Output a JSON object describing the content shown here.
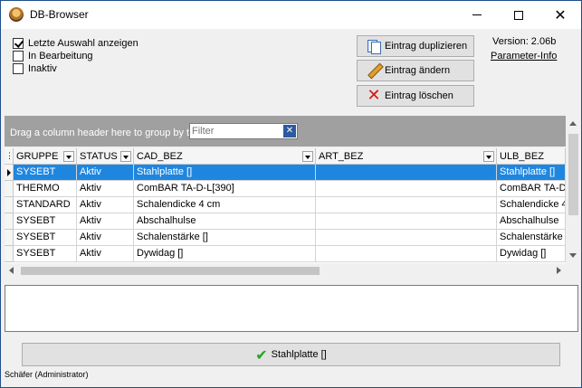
{
  "window": {
    "title": "DB-Browser"
  },
  "options": [
    {
      "label": "Letzte Auswahl anzeigen",
      "checked": true
    },
    {
      "label": "In Bearbeitung",
      "checked": false
    },
    {
      "label": "Inaktiv",
      "checked": false
    }
  ],
  "actions": {
    "duplicate": "Eintrag duplizieren",
    "edit": "Eintrag ändern",
    "delete": "Eintrag löschen"
  },
  "info": {
    "version": "Version: 2.06b",
    "param_link": "Parameter-Info"
  },
  "grid": {
    "group_hint": "Drag a column header here to group by t",
    "filter_placeholder": "Filter",
    "columns": [
      "GRUPPE",
      "STATUS",
      "CAD_BEZ",
      "ART_BEZ",
      "ULB_BEZ"
    ],
    "rows": [
      [
        "SYSEBT",
        "Aktiv",
        "Stahlplatte []",
        "",
        "Stahlplatte []"
      ],
      [
        "THERMO",
        "Aktiv",
        "ComBAR TA-D-L[390]",
        "",
        "ComBAR TA-D-"
      ],
      [
        "STANDARD",
        "Aktiv",
        "Schalendicke 4 cm",
        "",
        "Schalendicke 4"
      ],
      [
        "SYSEBT",
        "Aktiv",
        "Abschalhulse",
        "",
        "Abschalhulse"
      ],
      [
        "SYSEBT",
        "Aktiv",
        "Schalenstärke []",
        "",
        "Schalenstärke |"
      ],
      [
        "SYSEBT",
        "Aktiv",
        "Dywidag []",
        "",
        "Dywidag []"
      ]
    ],
    "selected_row": 0
  },
  "confirm": {
    "label": "Stahlplatte []"
  },
  "status": {
    "user": "Schäfer (Administrator)"
  }
}
